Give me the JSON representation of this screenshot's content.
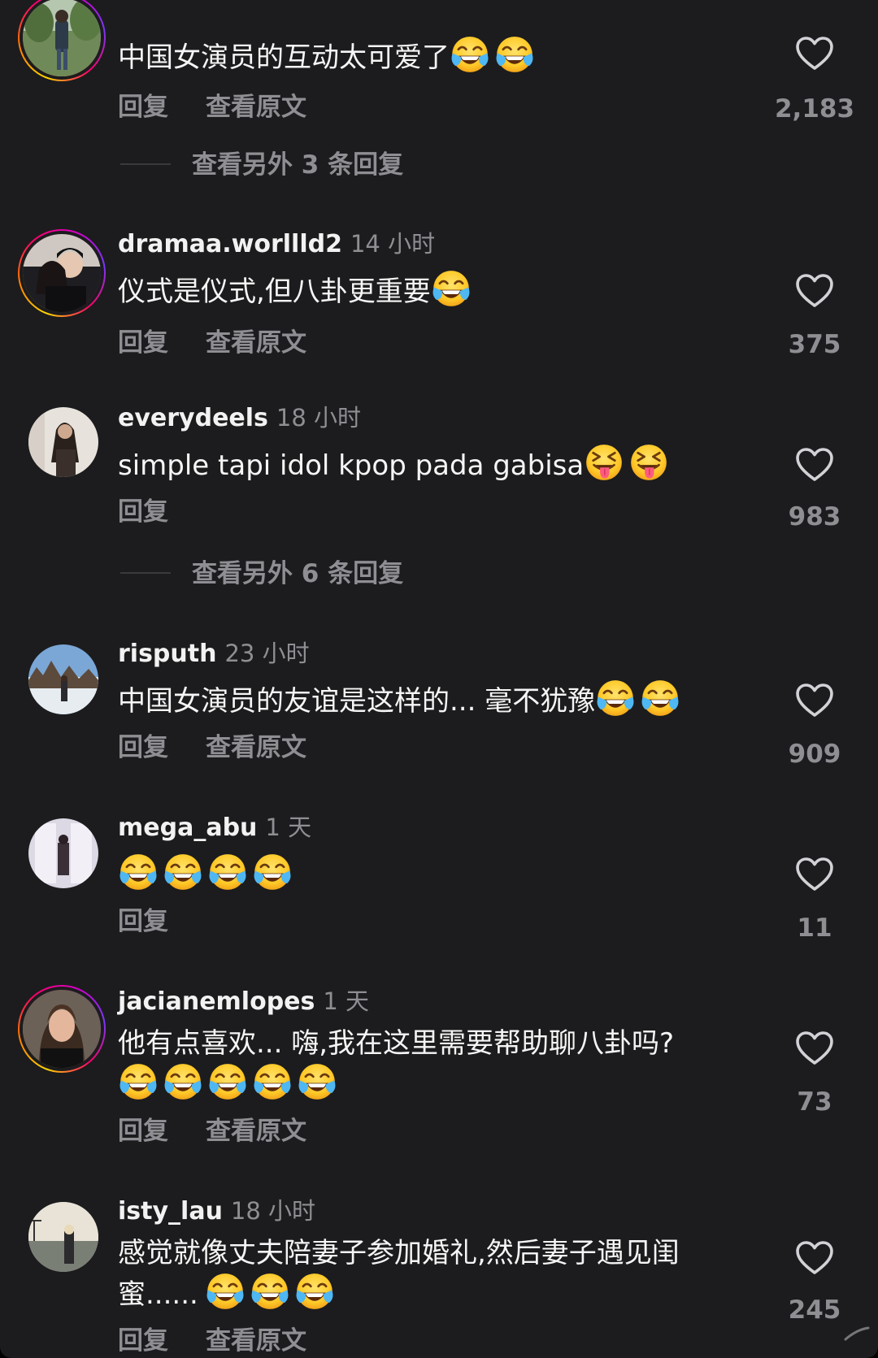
{
  "labels": {
    "reply": "回复",
    "see_translation": "查看原文"
  },
  "top_comment": {
    "username": "",
    "time": "",
    "text": "中国女演员的互动太可爱了",
    "emojis": [
      "face-with-tears-of-joy",
      "face-with-tears-of-joy"
    ],
    "likes": "2,183",
    "more_replies": "查看另外 3 条回复"
  },
  "comments": [
    {
      "username": "dramaa.worllld2",
      "time": "14 小时",
      "text": "仪式是仪式,但八卦更重要",
      "emojis": [
        "face-with-tears-of-joy"
      ],
      "likes": "375",
      "has_story_ring": true
    },
    {
      "username": "everydeels",
      "time": "18 小时",
      "text": "simple tapi idol kpop pada gabisa",
      "emojis": [
        "squinting-face-with-tongue",
        "squinting-face-with-tongue"
      ],
      "likes": "983",
      "has_story_ring": false,
      "more_replies": "查看另外 6 条回复"
    },
    {
      "username": "risputh",
      "time": "23 小时",
      "text": "中国女演员的友谊是这样的... 毫不犹豫",
      "emojis": [
        "face-with-tears-of-joy",
        "face-with-tears-of-joy"
      ],
      "likes": "909",
      "has_story_ring": false
    },
    {
      "username": "mega_abu",
      "time": "1 天",
      "text": "",
      "emojis": [
        "face-with-tears-of-joy",
        "face-with-tears-of-joy",
        "face-with-tears-of-joy",
        "face-with-tears-of-joy"
      ],
      "likes": "11",
      "has_story_ring": false
    },
    {
      "username": "jacianemlopes",
      "time": "1 天",
      "text": "他有点喜欢... 嗨,我在这里需要帮助聊八卦吗?",
      "emojis": [
        "face-with-tears-of-joy",
        "face-with-tears-of-joy",
        "face-with-tears-of-joy",
        "face-with-tears-of-joy",
        "face-with-tears-of-joy"
      ],
      "likes": "73",
      "has_story_ring": true
    },
    {
      "username": "isty_lau",
      "time": "18 小时",
      "text_line1": "感觉就像丈夫陪妻子参加婚礼,然后妻子遇见闺",
      "text_line2": "蜜......",
      "emojis": [
        "face-with-tears-of-joy",
        "face-with-tears-of-joy",
        "face-with-tears-of-joy"
      ],
      "likes": "245",
      "has_story_ring": false
    }
  ],
  "colors": {
    "background": "#1c1c1e",
    "primary_text": "#f5f5f5",
    "secondary_text": "#8e8e93",
    "story_ring": [
      "#ffd600",
      "#ff7a00",
      "#ff0069",
      "#d300c5",
      "#7638fa"
    ]
  }
}
